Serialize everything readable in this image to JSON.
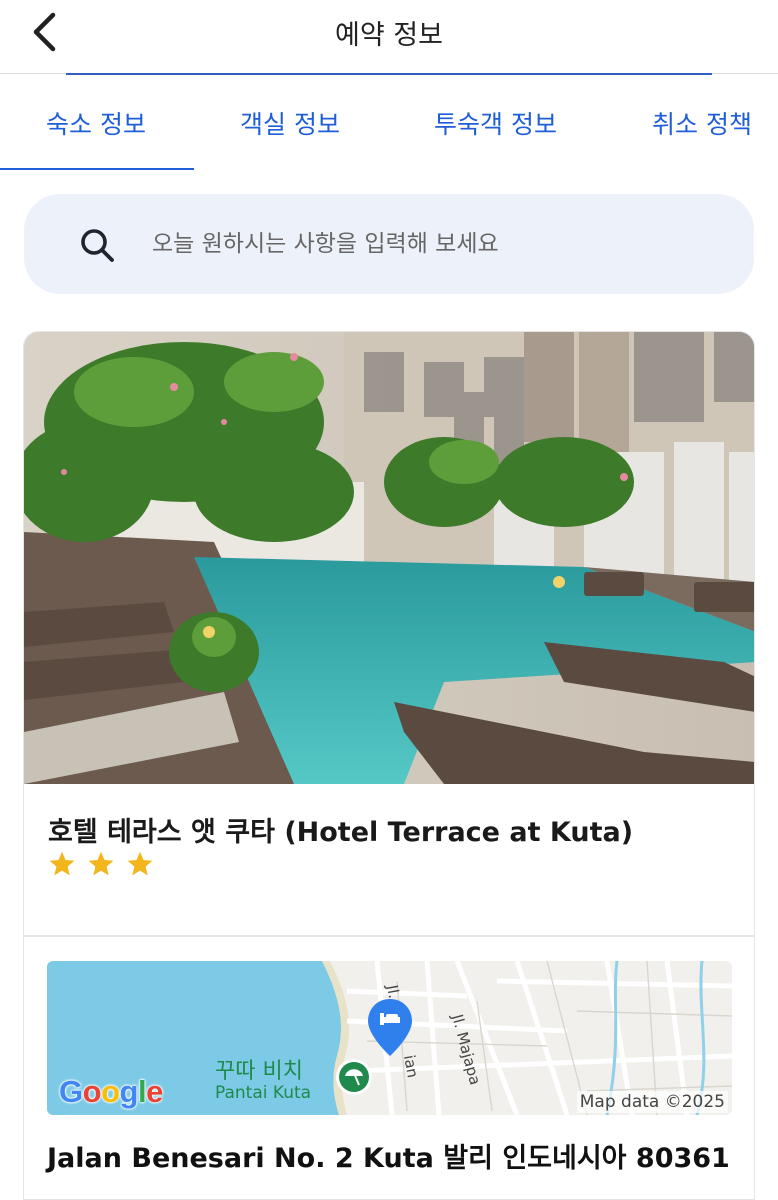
{
  "header": {
    "title": "예약 정보"
  },
  "tabs": [
    {
      "label": "숙소 정보",
      "active": true
    },
    {
      "label": "객실 정보",
      "active": false
    },
    {
      "label": "투숙객 정보",
      "active": false
    },
    {
      "label": "취소 정책",
      "active": false
    }
  ],
  "search": {
    "placeholder": "오늘 원하시는 사항을 입력해 보세요"
  },
  "hotel": {
    "name": "호텔 테라스 앳 쿠타 (Hotel Terrace at Kuta)",
    "star_rating": 3,
    "address": "Jalan Benesari No. 2 Kuta 발리 인도네시아 80361"
  },
  "map": {
    "poi_name_ko": "꾸따 비치",
    "poi_name_en": "Pantai Kuta",
    "road_label_1": "Jl.",
    "road_label_2": "ian",
    "road_label_3": "Jl. Majapa",
    "attribution": "Map data ©2025",
    "provider": "Google"
  },
  "colors": {
    "accent": "#1f5ed8",
    "star": "#f2b61c",
    "search_bg": "#edf2fa",
    "map_sea": "#7ccae6",
    "pin": "#2f80ed",
    "poi_green": "#1f8a4c"
  }
}
